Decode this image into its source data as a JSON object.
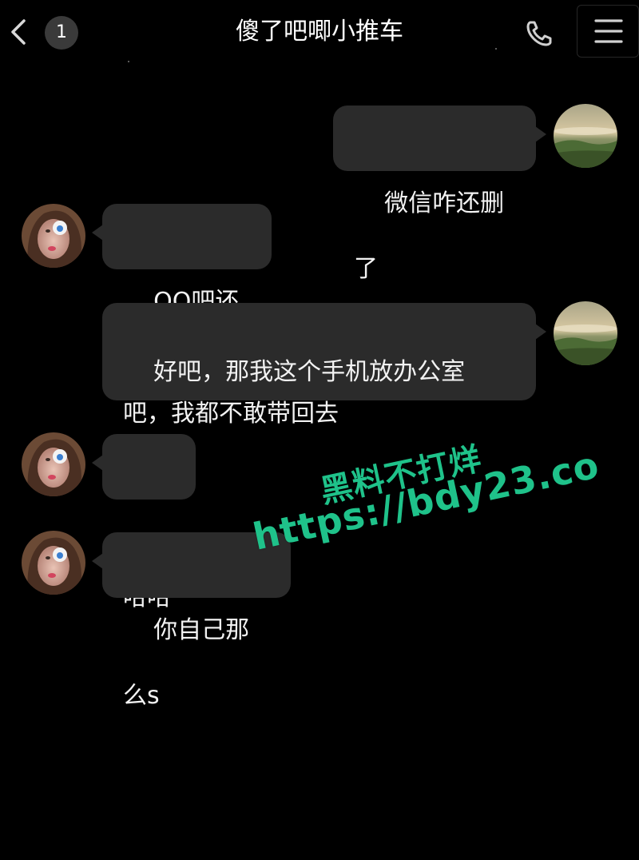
{
  "header": {
    "title": "傻了吧唧小推车",
    "unread_count": "1",
    "back_icon": "chevron-left-icon",
    "call_icon": "phone-icon",
    "menu_icon": "menu-icon"
  },
  "messages": [
    {
      "sender": "me",
      "text": "微信咋还删了",
      "avatar": "landscape-avatar"
    },
    {
      "sender": "contact",
      "text": "QQ吧还是",
      "avatar": "girl-avatar"
    },
    {
      "sender": "me",
      "text": "好吧，那我这个手机放办公室\n吧，我都不敢带回去",
      "avatar": "landscape-avatar"
    },
    {
      "sender": "contact",
      "text": "哈哈",
      "avatar": "girl-avatar"
    },
    {
      "sender": "contact",
      "text": "你自己那么s",
      "avatar": "girl-avatar"
    }
  ],
  "watermark": {
    "line1": "黑料不打烊",
    "line2": "https://bdy23.co",
    "color": "#1fc28a"
  },
  "colors": {
    "background": "#000000",
    "bubble": "#2b2b2b",
    "text": "#ffffff"
  }
}
